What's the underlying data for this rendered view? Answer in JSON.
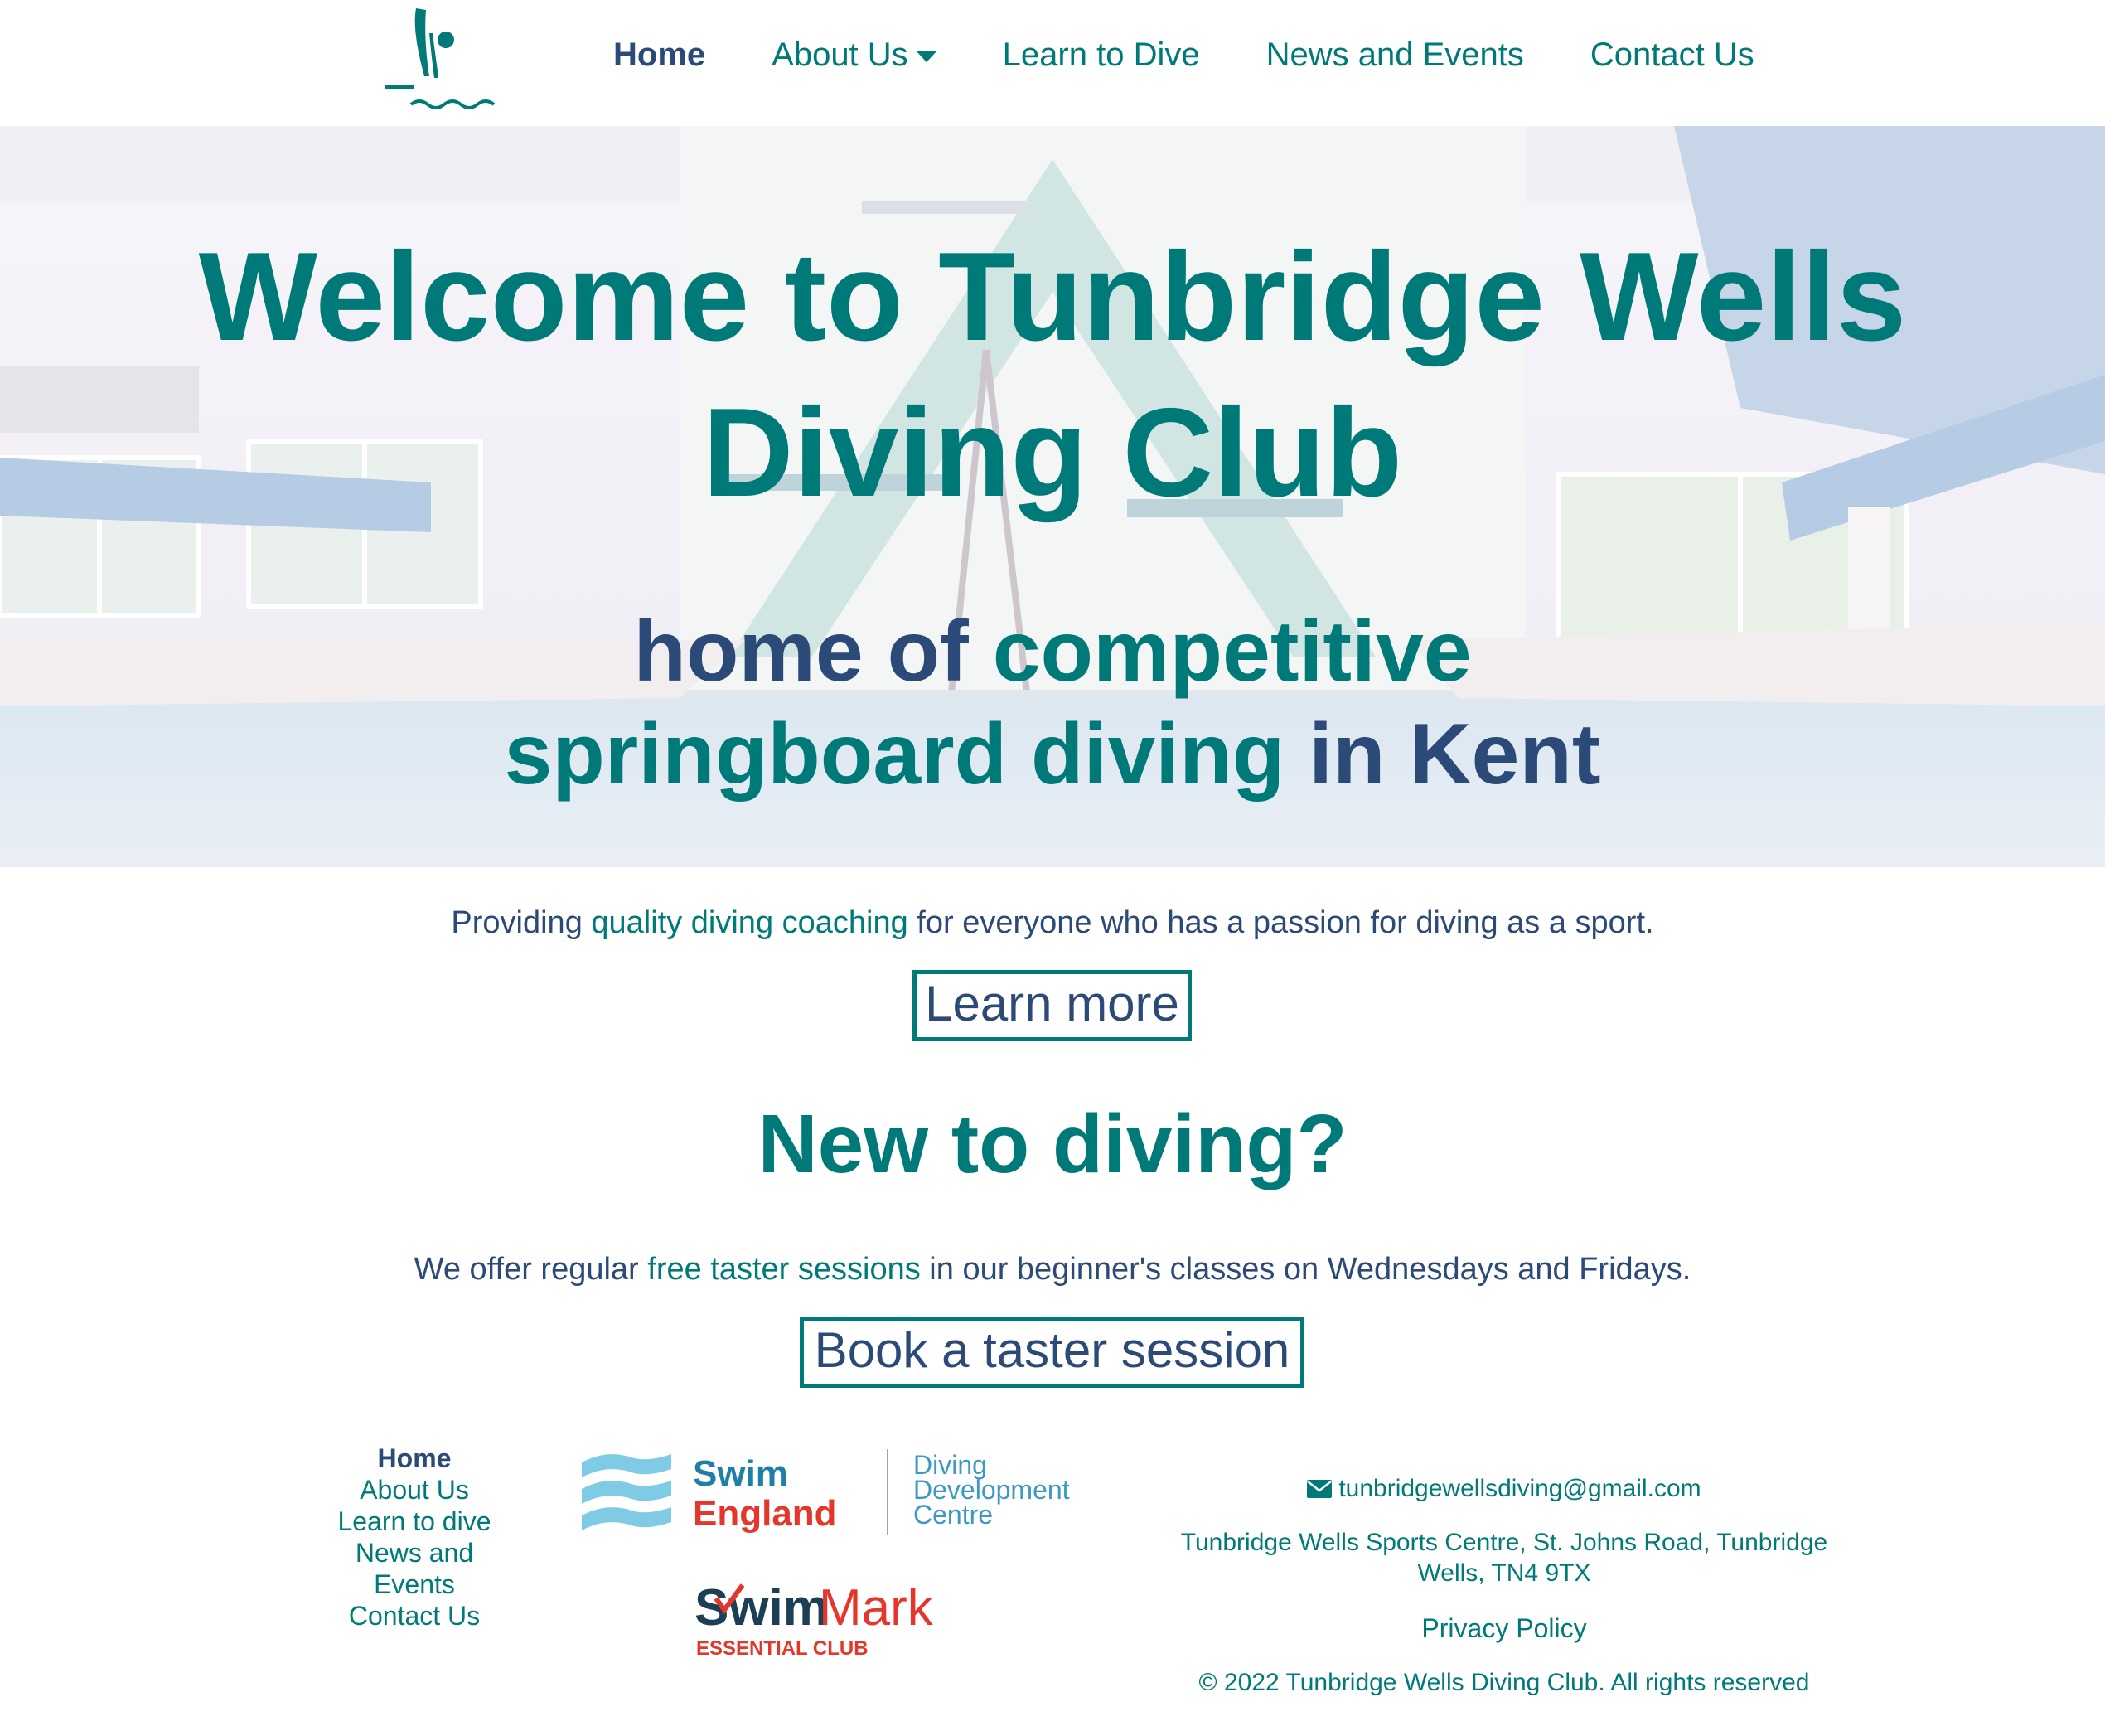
{
  "nav": {
    "items": [
      {
        "label": "Home",
        "active": true
      },
      {
        "label": "About Us",
        "dropdown": true
      },
      {
        "label": "Learn to Dive"
      },
      {
        "label": "News and Events"
      },
      {
        "label": "Contact Us"
      }
    ]
  },
  "hero": {
    "title": "Welcome to Tunbridge Wells Diving Club",
    "subtitle_part1": "home of ",
    "subtitle_part2": "competitive springboard diving",
    "subtitle_part3": " in Kent"
  },
  "intro": {
    "text_part1": "Providing ",
    "text_highlight": "quality diving coaching",
    "text_part2": " for everyone who has a passion for diving as a sport.",
    "button_label": "Learn more"
  },
  "new_to_diving": {
    "heading": "New to diving?",
    "text_part1": "We offer regular ",
    "text_highlight": "free taster sessions",
    "text_part2": " in our beginner's classes on Wednesdays and Fridays.",
    "button_label": "Book a taster session"
  },
  "footer": {
    "nav": [
      "Home",
      "About Us",
      "Learn to dive",
      "News and Events",
      "Contact Us"
    ],
    "swim_england": {
      "line1": "Swim",
      "line2": "England",
      "ddc1": "Diving",
      "ddc2": "Development",
      "ddc3": "Centre"
    },
    "swimmark": {
      "part1": "Swim",
      "part2": "Mark",
      "tagline": "ESSENTIAL CLUB"
    },
    "email": "tunbridgewellsdiving@gmail.com",
    "address": "Tunbridge Wells Sports Centre, St. Johns Road, Tunbridge Wells, TN4 9TX",
    "privacy": "Privacy Policy",
    "copyright": "© 2022 Tunbridge Wells Diving Club. All rights reserved"
  },
  "colors": {
    "teal": "#007a78",
    "navy": "#2c4a78",
    "swim_england_red": "#e4362a",
    "swim_england_blue": "#1f7fa6"
  },
  "icons": [
    "club-logo-diver-icon",
    "chevron-down-icon",
    "envelope-icon"
  ]
}
